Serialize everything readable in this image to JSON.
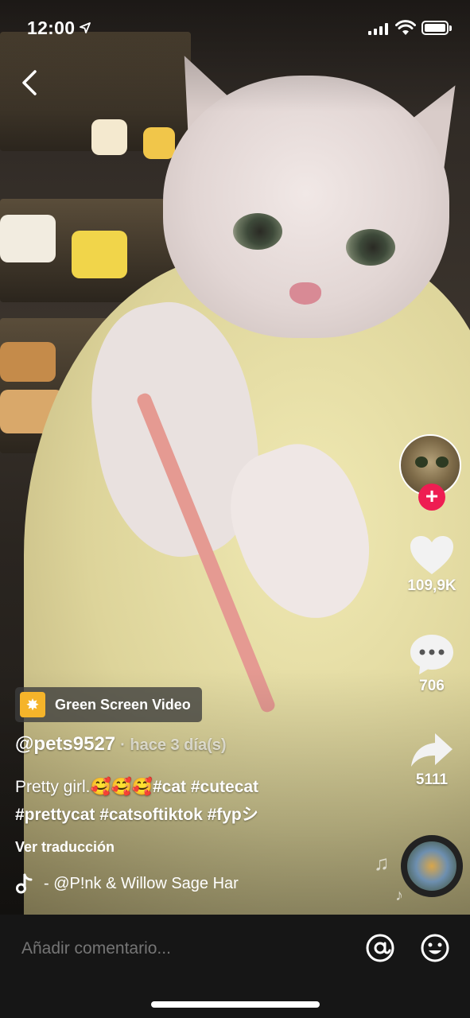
{
  "status_bar": {
    "time": "12:00"
  },
  "green_screen": {
    "label": "Green Screen Video",
    "icon": "sparkle-icon"
  },
  "post": {
    "username": "@pets9527",
    "when": "· hace 3 día(s)",
    "caption_text": "Pretty girl.🥰🥰🥰",
    "caption_tags_1": "#cat #cutecat",
    "caption_tags_2": "#prettycat #catsoftiktok #fypシ",
    "translate_label": "Ver traducción",
    "sound": "- @P!nk & Willow Sage Har"
  },
  "rail": {
    "likes": "109,9K",
    "comments": "706",
    "shares": "5111",
    "follow_symbol": "+"
  },
  "comment_bar": {
    "placeholder": "Añadir comentario..."
  },
  "colors": {
    "follow_accent": "#ee1d52",
    "bar_bg": "#161616",
    "chip_icon": "#f5b42a"
  }
}
